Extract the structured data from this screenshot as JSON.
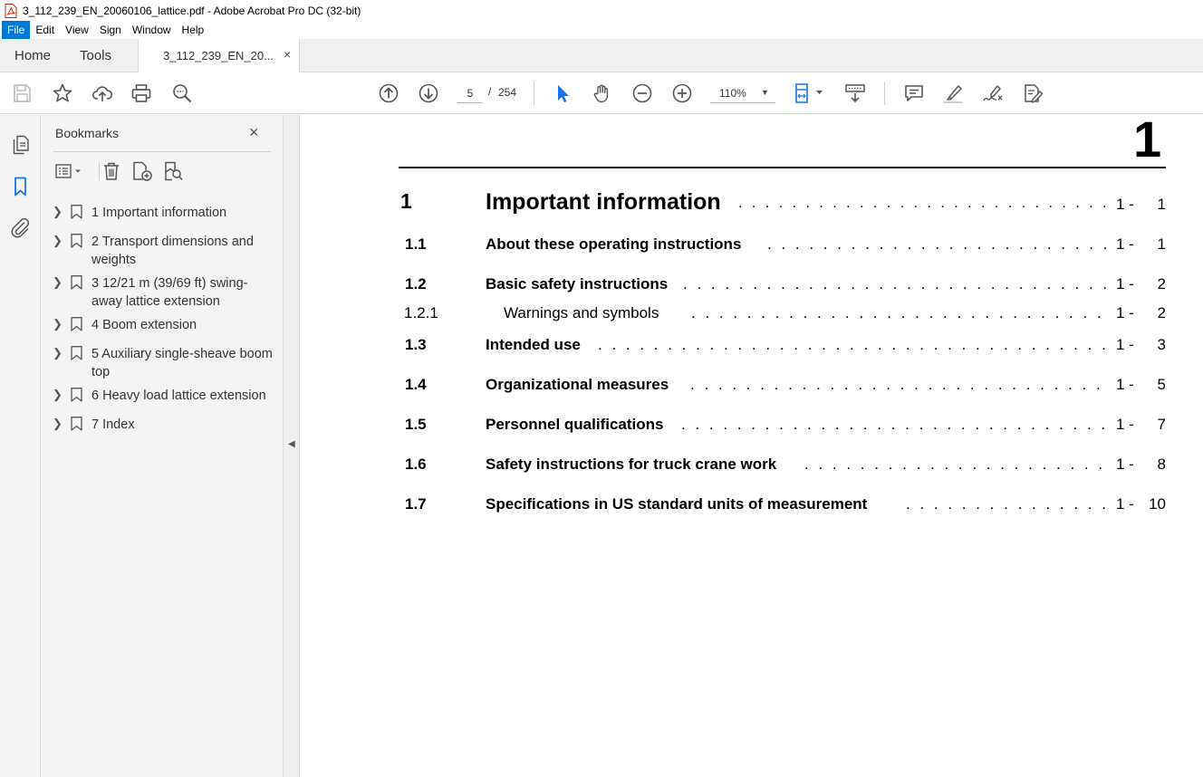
{
  "window": {
    "title": "3_112_239_EN_20060106_lattice.pdf - Adobe Acrobat Pro DC (32-bit)"
  },
  "menu": [
    "File",
    "Edit",
    "View",
    "Sign",
    "Window",
    "Help"
  ],
  "tabs": {
    "home": "Home",
    "tools": "Tools",
    "document": "3_112_239_EN_20...",
    "close": "×"
  },
  "toolbar": {
    "page_current": "5",
    "page_separator": "/",
    "page_total": "254",
    "zoom": "110%",
    "icons": [
      "save-icon",
      "star-icon",
      "cloud-upload-icon",
      "print-icon",
      "search-zoom-icon",
      "page-up-icon",
      "page-down-icon",
      "select-cursor-icon",
      "hand-icon",
      "zoom-out-icon",
      "zoom-in-icon",
      "page-fit-icon",
      "scroll-mode-icon",
      "comment-icon",
      "highlight-icon",
      "sign-icon",
      "fill-sign-icon"
    ]
  },
  "bookmarks": {
    "title": "Bookmarks",
    "close": "×",
    "items": [
      {
        "label": "1 Important information"
      },
      {
        "label": "2 Transport dimensions and weights"
      },
      {
        "label": "3 12/21 m (39/69 ft) swing-away lattice extension"
      },
      {
        "label": "4 Boom extension"
      },
      {
        "label": "5 Auxiliary single-sheave boom top"
      },
      {
        "label": "6 Heavy load lattice extension"
      },
      {
        "label": "7 Index"
      }
    ]
  },
  "document": {
    "chapter_number": "1",
    "toc": [
      {
        "num": "1",
        "title": "Important information",
        "chapter": "1 -",
        "page": "1"
      },
      {
        "num": "1.1",
        "title": "About these operating instructions",
        "chapter": "1 -",
        "page": "1"
      },
      {
        "num": "1.2",
        "title": "Basic safety instructions",
        "chapter": "1 -",
        "page": "2"
      },
      {
        "num": "1.2.1",
        "title": "Warnings and symbols",
        "chapter": "1 -",
        "page": "2"
      },
      {
        "num": "1.3",
        "title": "Intended use",
        "chapter": "1 -",
        "page": "3"
      },
      {
        "num": "1.4",
        "title": "Organizational measures",
        "chapter": "1 -",
        "page": "5"
      },
      {
        "num": "1.5",
        "title": "Personnel qualifications",
        "chapter": "1 -",
        "page": "7"
      },
      {
        "num": "1.6",
        "title": "Safety instructions for truck crane work",
        "chapter": "1 -",
        "page": "8"
      },
      {
        "num": "1.7",
        "title": "Specifications in US standard units of measurement",
        "chapter": "1 -",
        "page": "10"
      }
    ]
  },
  "colors": {
    "accent": "#0078d7",
    "icon": "#555555",
    "select_blue": "#1473e6"
  }
}
